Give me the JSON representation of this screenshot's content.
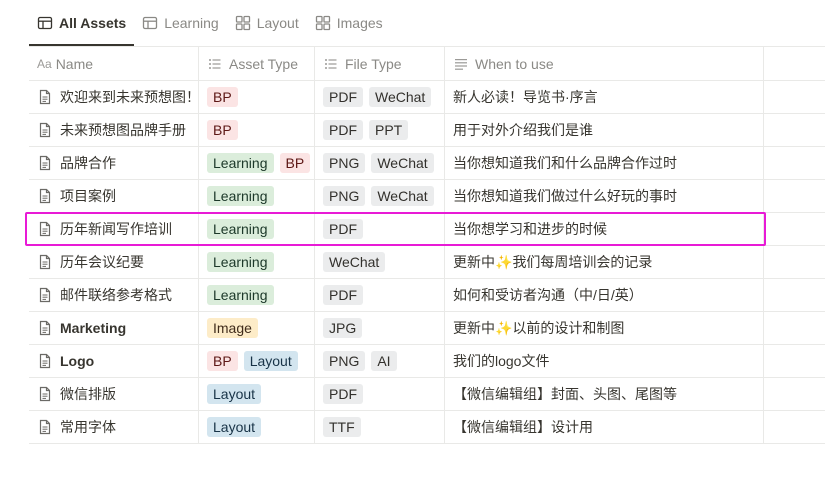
{
  "tabs": [
    {
      "label": "All Assets",
      "icon": "table-icon",
      "active": true
    },
    {
      "label": "Learning",
      "icon": "table-icon",
      "active": false
    },
    {
      "label": "Layout",
      "icon": "gallery-icon",
      "active": false
    },
    {
      "label": "Images",
      "icon": "gallery-icon",
      "active": false
    }
  ],
  "columns": {
    "name": {
      "prefix": "Aa",
      "label": "Name"
    },
    "asset_type": {
      "label": "Asset Type",
      "icon": "list-icon"
    },
    "file_type": {
      "label": "File Type",
      "icon": "list-icon"
    },
    "when": {
      "label": "When to use",
      "icon": "text-lines-icon"
    }
  },
  "rows": [
    {
      "name": "欢迎来到未来预想图！",
      "bold": false,
      "asset": [
        {
          "t": "BP",
          "c": "bp"
        }
      ],
      "file": [
        "PDF",
        "WeChat"
      ],
      "when": "新人必读！导览书·序言"
    },
    {
      "name": "未来预想图品牌手册",
      "bold": false,
      "asset": [
        {
          "t": "BP",
          "c": "bp"
        }
      ],
      "file": [
        "PDF",
        "PPT"
      ],
      "when": "用于对外介绍我们是谁"
    },
    {
      "name": "品牌合作",
      "bold": false,
      "asset": [
        {
          "t": "Learning",
          "c": "learning"
        },
        {
          "t": "BP",
          "c": "bp"
        }
      ],
      "file": [
        "PNG",
        "WeChat"
      ],
      "when": "当你想知道我们和什么品牌合作过时"
    },
    {
      "name": "项目案例",
      "bold": false,
      "asset": [
        {
          "t": "Learning",
          "c": "learning"
        }
      ],
      "file": [
        "PNG",
        "WeChat"
      ],
      "when": "当你想知道我们做过什么好玩的事时"
    },
    {
      "name": "历年新闻写作培训",
      "bold": false,
      "asset": [
        {
          "t": "Learning",
          "c": "learning"
        }
      ],
      "file": [
        "PDF"
      ],
      "when": "当你想学习和进步的时候"
    },
    {
      "name": "历年会议纪要",
      "bold": false,
      "asset": [
        {
          "t": "Learning",
          "c": "learning"
        }
      ],
      "file": [
        "WeChat"
      ],
      "when_pre": "更新中",
      "spark": "✨",
      "when": "我们每周培训会的记录"
    },
    {
      "name": "邮件联络参考格式",
      "bold": false,
      "asset": [
        {
          "t": "Learning",
          "c": "learning"
        }
      ],
      "file": [
        "PDF"
      ],
      "when": "如何和受访者沟通（中/日/英）"
    },
    {
      "name": "Marketing",
      "bold": true,
      "asset": [
        {
          "t": "Image",
          "c": "image"
        }
      ],
      "file": [
        "JPG"
      ],
      "when_pre": "更新中",
      "spark": "✨",
      "when": "以前的设计和制图"
    },
    {
      "name": "Logo",
      "bold": true,
      "asset": [
        {
          "t": "BP",
          "c": "bp"
        },
        {
          "t": "Layout",
          "c": "layout"
        }
      ],
      "file": [
        "PNG",
        "AI"
      ],
      "when": "我们的logo文件"
    },
    {
      "name": "微信排版",
      "bold": false,
      "asset": [
        {
          "t": "Layout",
          "c": "layout"
        }
      ],
      "file": [
        "PDF"
      ],
      "when": "【微信编辑组】封面、头图、尾图等"
    },
    {
      "name": "常用字体",
      "bold": false,
      "asset": [
        {
          "t": "Layout",
          "c": "layout"
        }
      ],
      "file": [
        "TTF"
      ],
      "when": "【微信编辑组】设计用"
    }
  ],
  "highlighted_row": 4,
  "colors": {
    "highlight": "#e81ad6",
    "border": "#e9e9e7"
  }
}
